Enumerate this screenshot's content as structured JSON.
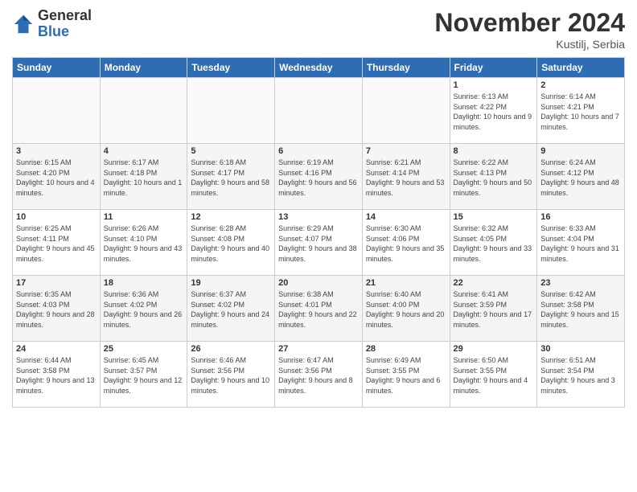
{
  "header": {
    "logo_general": "General",
    "logo_blue": "Blue",
    "month_title": "November 2024",
    "location": "Kustilj, Serbia"
  },
  "days_of_week": [
    "Sunday",
    "Monday",
    "Tuesday",
    "Wednesday",
    "Thursday",
    "Friday",
    "Saturday"
  ],
  "weeks": [
    [
      {
        "day": "",
        "info": ""
      },
      {
        "day": "",
        "info": ""
      },
      {
        "day": "",
        "info": ""
      },
      {
        "day": "",
        "info": ""
      },
      {
        "day": "",
        "info": ""
      },
      {
        "day": "1",
        "info": "Sunrise: 6:13 AM\nSunset: 4:22 PM\nDaylight: 10 hours and 9 minutes."
      },
      {
        "day": "2",
        "info": "Sunrise: 6:14 AM\nSunset: 4:21 PM\nDaylight: 10 hours and 7 minutes."
      }
    ],
    [
      {
        "day": "3",
        "info": "Sunrise: 6:15 AM\nSunset: 4:20 PM\nDaylight: 10 hours and 4 minutes."
      },
      {
        "day": "4",
        "info": "Sunrise: 6:17 AM\nSunset: 4:18 PM\nDaylight: 10 hours and 1 minute."
      },
      {
        "day": "5",
        "info": "Sunrise: 6:18 AM\nSunset: 4:17 PM\nDaylight: 9 hours and 58 minutes."
      },
      {
        "day": "6",
        "info": "Sunrise: 6:19 AM\nSunset: 4:16 PM\nDaylight: 9 hours and 56 minutes."
      },
      {
        "day": "7",
        "info": "Sunrise: 6:21 AM\nSunset: 4:14 PM\nDaylight: 9 hours and 53 minutes."
      },
      {
        "day": "8",
        "info": "Sunrise: 6:22 AM\nSunset: 4:13 PM\nDaylight: 9 hours and 50 minutes."
      },
      {
        "day": "9",
        "info": "Sunrise: 6:24 AM\nSunset: 4:12 PM\nDaylight: 9 hours and 48 minutes."
      }
    ],
    [
      {
        "day": "10",
        "info": "Sunrise: 6:25 AM\nSunset: 4:11 PM\nDaylight: 9 hours and 45 minutes."
      },
      {
        "day": "11",
        "info": "Sunrise: 6:26 AM\nSunset: 4:10 PM\nDaylight: 9 hours and 43 minutes."
      },
      {
        "day": "12",
        "info": "Sunrise: 6:28 AM\nSunset: 4:08 PM\nDaylight: 9 hours and 40 minutes."
      },
      {
        "day": "13",
        "info": "Sunrise: 6:29 AM\nSunset: 4:07 PM\nDaylight: 9 hours and 38 minutes."
      },
      {
        "day": "14",
        "info": "Sunrise: 6:30 AM\nSunset: 4:06 PM\nDaylight: 9 hours and 35 minutes."
      },
      {
        "day": "15",
        "info": "Sunrise: 6:32 AM\nSunset: 4:05 PM\nDaylight: 9 hours and 33 minutes."
      },
      {
        "day": "16",
        "info": "Sunrise: 6:33 AM\nSunset: 4:04 PM\nDaylight: 9 hours and 31 minutes."
      }
    ],
    [
      {
        "day": "17",
        "info": "Sunrise: 6:35 AM\nSunset: 4:03 PM\nDaylight: 9 hours and 28 minutes."
      },
      {
        "day": "18",
        "info": "Sunrise: 6:36 AM\nSunset: 4:02 PM\nDaylight: 9 hours and 26 minutes."
      },
      {
        "day": "19",
        "info": "Sunrise: 6:37 AM\nSunset: 4:02 PM\nDaylight: 9 hours and 24 minutes."
      },
      {
        "day": "20",
        "info": "Sunrise: 6:38 AM\nSunset: 4:01 PM\nDaylight: 9 hours and 22 minutes."
      },
      {
        "day": "21",
        "info": "Sunrise: 6:40 AM\nSunset: 4:00 PM\nDaylight: 9 hours and 20 minutes."
      },
      {
        "day": "22",
        "info": "Sunrise: 6:41 AM\nSunset: 3:59 PM\nDaylight: 9 hours and 17 minutes."
      },
      {
        "day": "23",
        "info": "Sunrise: 6:42 AM\nSunset: 3:58 PM\nDaylight: 9 hours and 15 minutes."
      }
    ],
    [
      {
        "day": "24",
        "info": "Sunrise: 6:44 AM\nSunset: 3:58 PM\nDaylight: 9 hours and 13 minutes."
      },
      {
        "day": "25",
        "info": "Sunrise: 6:45 AM\nSunset: 3:57 PM\nDaylight: 9 hours and 12 minutes."
      },
      {
        "day": "26",
        "info": "Sunrise: 6:46 AM\nSunset: 3:56 PM\nDaylight: 9 hours and 10 minutes."
      },
      {
        "day": "27",
        "info": "Sunrise: 6:47 AM\nSunset: 3:56 PM\nDaylight: 9 hours and 8 minutes."
      },
      {
        "day": "28",
        "info": "Sunrise: 6:49 AM\nSunset: 3:55 PM\nDaylight: 9 hours and 6 minutes."
      },
      {
        "day": "29",
        "info": "Sunrise: 6:50 AM\nSunset: 3:55 PM\nDaylight: 9 hours and 4 minutes."
      },
      {
        "day": "30",
        "info": "Sunrise: 6:51 AM\nSunset: 3:54 PM\nDaylight: 9 hours and 3 minutes."
      }
    ]
  ]
}
